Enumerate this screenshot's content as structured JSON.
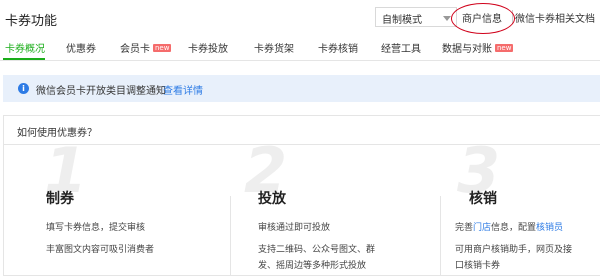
{
  "header": {
    "title": "卡券功能",
    "mode_select": "自制模式",
    "merchant_link": "商户信息",
    "docs_link": "微信卡券相关文档"
  },
  "tabs": [
    {
      "label": "卡券概况",
      "active": true
    },
    {
      "label": "优惠券"
    },
    {
      "label": "会员卡",
      "badge": "new"
    },
    {
      "label": "卡券投放"
    },
    {
      "label": "卡券货架"
    },
    {
      "label": "卡券核销"
    },
    {
      "label": "经营工具"
    },
    {
      "label": "数据与对账",
      "badge": "new"
    }
  ],
  "notice": {
    "text": "微信会员卡开放类目调整通知",
    "link": "查看详情"
  },
  "guide": {
    "title": "如何使用优惠券？",
    "steps": [
      {
        "num": "1",
        "title": "制券",
        "lines": [
          "填写卡券信息，提交审核",
          "丰富图文内容可吸引消费者"
        ]
      },
      {
        "num": "2",
        "title": "投放",
        "lines": [
          "审核通过即可投放",
          "支持二维码、公众号图文、群",
          "发、摇周边等多种形式投放"
        ]
      },
      {
        "num": "3",
        "title": "核销",
        "line1_prefix": "完善",
        "line1_link1": "门店",
        "line1_mid": "信息，配置",
        "line1_link2": "核销员",
        "lines": [
          "可用商户核销助手，网页及接",
          "口核销卡券"
        ]
      }
    ]
  },
  "colors": {
    "accent": "#1aad19",
    "link": "#2d7be5",
    "highlight": "#d0021b"
  }
}
